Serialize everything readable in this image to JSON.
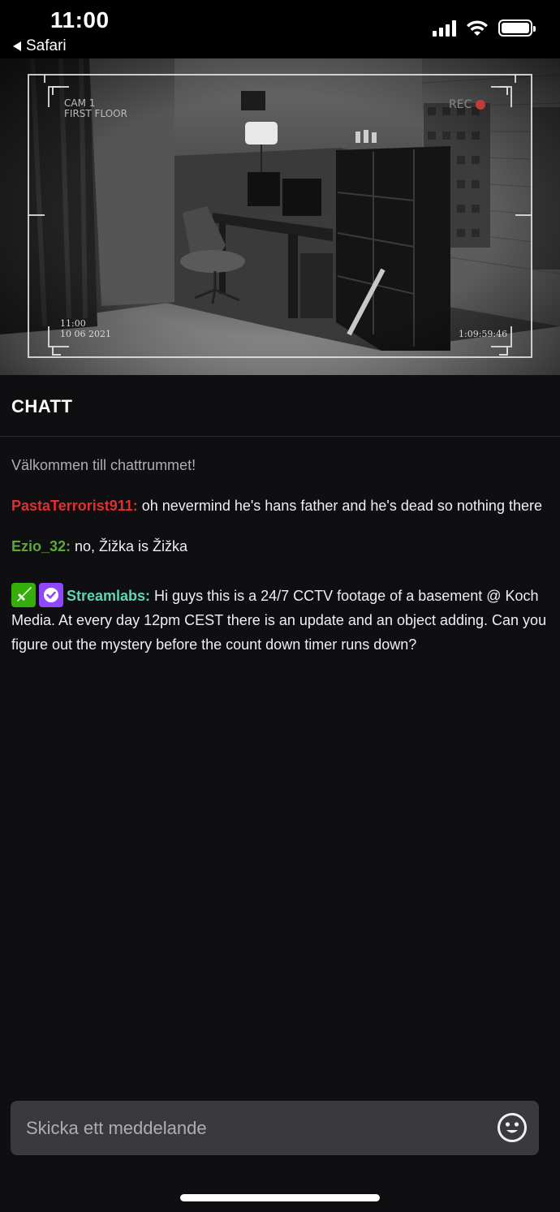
{
  "status_bar": {
    "time": "11:00",
    "back_app": "Safari",
    "icons": [
      "cellular-signal-icon",
      "wifi-icon",
      "battery-icon"
    ]
  },
  "video": {
    "cam_label": "CAM 1",
    "floor_label": "FIRST FLOOR",
    "rec_label": "REC",
    "overlay_time": "11:00",
    "overlay_date": "10 06 2021",
    "overlay_timer": "1:09:59:46"
  },
  "chat": {
    "title": "CHATT",
    "welcome": "Välkommen till chattrummet!",
    "messages": [
      {
        "user": "PastaTerrorist911:",
        "text": " oh nevermind he's hans father and he's dead so nothing there",
        "color": "#e02e2e"
      },
      {
        "user": "Ezio_32:",
        "text": " no, Žižka is Žižka",
        "color": "#5ea838"
      },
      {
        "user": "Streamlabs:",
        "text": " Hi guys this is a 24/7 CCTV footage of a basement @ Koch Media. At every day 12pm CEST there is an update and an object adding. Can you figure out the mystery before the count down timer runs down?",
        "color": "#5dd6b1",
        "badges": [
          "moderator-sword-icon",
          "verified-check-icon"
        ]
      }
    ]
  },
  "input": {
    "placeholder": "Skicka ett meddelande",
    "emoji_icon": "smiley-face-icon"
  }
}
